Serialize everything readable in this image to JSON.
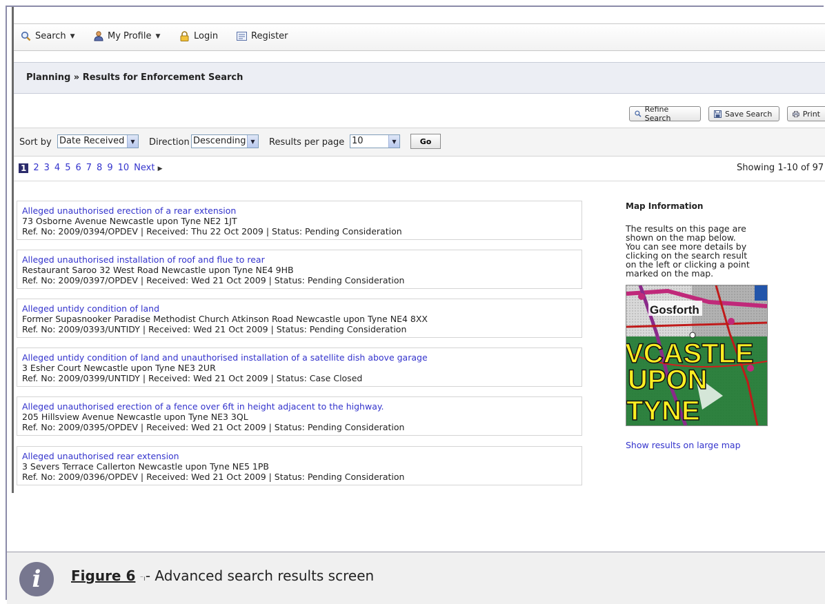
{
  "nav": {
    "search": "Search",
    "my_profile": "My Profile",
    "login": "Login",
    "register": "Register"
  },
  "breadcrumb": "Planning » Results for Enforcement Search",
  "actions": {
    "refine": "Refine Search",
    "save": "Save Search",
    "print": "Print"
  },
  "sort": {
    "sort_by_label": "Sort by",
    "sort_by_value": "Date Received",
    "direction_label": "Direction",
    "direction_value": "Descending",
    "per_page_label": "Results per page",
    "per_page_value": "10",
    "go_label": "Go"
  },
  "pagination": {
    "current": "1",
    "pages": [
      "2",
      "3",
      "4",
      "5",
      "6",
      "7",
      "8",
      "9",
      "10"
    ],
    "next": "Next",
    "showing": "Showing 1-10 of 97"
  },
  "results": [
    {
      "title": "Alleged unauthorised erection of a rear extension",
      "address": "73 Osborne Avenue Newcastle upon Tyne NE2 1JT",
      "meta": "Ref. No: 2009/0394/OPDEV | Received: Thu 22 Oct 2009 | Status: Pending Consideration"
    },
    {
      "title": "Alleged unauthorised installation of roof and flue to rear",
      "address": "Restaurant Saroo 32 West Road Newcastle upon Tyne NE4 9HB",
      "meta": "Ref. No: 2009/0397/OPDEV | Received: Wed 21 Oct 2009 | Status: Pending Consideration"
    },
    {
      "title": "Alleged untidy condition of land",
      "address": "Former Supasnooker Paradise Methodist Church Atkinson Road Newcastle upon Tyne NE4 8XX",
      "meta": "Ref. No: 2009/0393/UNTIDY | Received: Wed 21 Oct 2009 | Status: Pending Consideration"
    },
    {
      "title": "Alleged untidy condition of land and unauthorised installation of a satellite dish above garage",
      "address": "3 Esher Court Newcastle upon Tyne NE3 2UR",
      "meta": "Ref. No: 2009/0399/UNTIDY | Received: Wed 21 Oct 2009 | Status: Case Closed"
    },
    {
      "title": "Alleged unauthorised erection of a fence over 6ft in height adjacent to the highway.",
      "address": "205 Hillsview Avenue Newcastle upon Tyne NE3 3QL",
      "meta": "Ref. No: 2009/0395/OPDEV | Received: Wed 21 Oct 2009 | Status: Pending Consideration"
    },
    {
      "title": "Alleged unauthorised rear extension",
      "address": "3 Severs Terrace Callerton Newcastle upon Tyne NE5 1PB",
      "meta": "Ref. No: 2009/0396/OPDEV | Received: Wed 21 Oct 2009 | Status: Pending Consideration"
    }
  ],
  "map_info": {
    "title": "Map Information",
    "description": "The results on this page are shown on the map below. You can see more details by clicking on the search result on the left or clicking a point marked on the map.",
    "map_labels": [
      "Gosforth",
      "VCASTLE",
      "UPON",
      "TYNE"
    ],
    "large_map_link": "Show results on large map"
  },
  "caption": {
    "figure": "Figure 6",
    "text": "- Advanced search results screen"
  },
  "colors": {
    "link": "#3333cc",
    "title_bar": "#eceef4",
    "caption_bg": "#f0f0f0"
  }
}
